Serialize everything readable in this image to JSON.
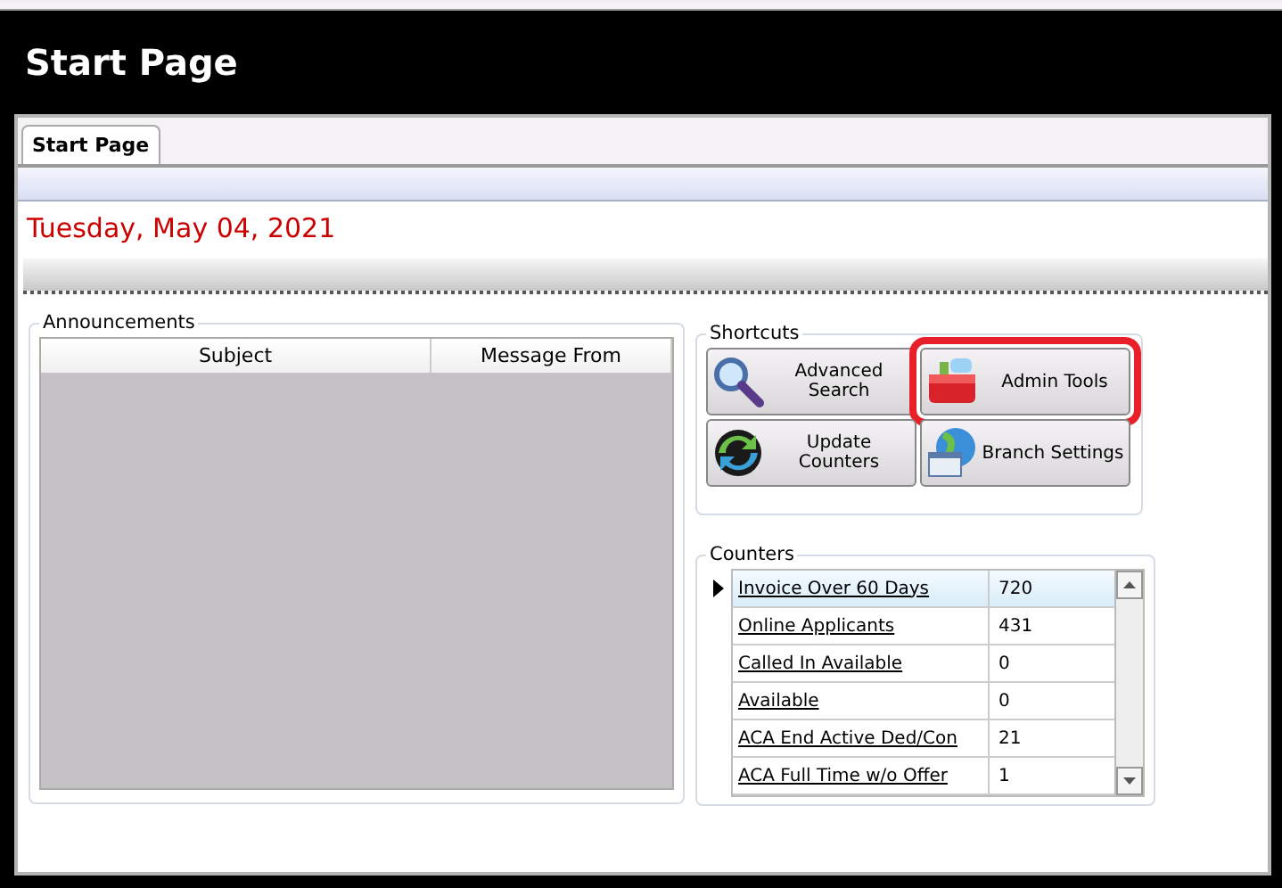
{
  "window": {
    "title": "Start Page"
  },
  "tabs": [
    {
      "label": "Start Page",
      "selected": true
    }
  ],
  "date": "Tuesday, May 04, 2021",
  "announcements": {
    "title": "Announcements",
    "columns": [
      "Subject",
      "Message From"
    ]
  },
  "shortcuts": {
    "title": "Shortcuts",
    "buttons": [
      {
        "label": "Advanced Search",
        "highlighted": false
      },
      {
        "label": "Admin Tools",
        "highlighted": true
      },
      {
        "label": "Update Counters",
        "highlighted": false
      },
      {
        "label": "Branch Settings",
        "highlighted": false
      }
    ]
  },
  "counters": {
    "title": "Counters",
    "rows": [
      {
        "name": "Invoice Over 60 Days",
        "value": "720",
        "selected": true
      },
      {
        "name": "Online Applicants",
        "value": "431",
        "selected": false
      },
      {
        "name": "Called In Available",
        "value": "0",
        "selected": false
      },
      {
        "name": "Available",
        "value": "0",
        "selected": false
      },
      {
        "name": "ACA End Active Ded/Con",
        "value": "21",
        "selected": false
      },
      {
        "name": "ACA Full Time w/o Offer",
        "value": "1",
        "selected": false
      }
    ]
  }
}
